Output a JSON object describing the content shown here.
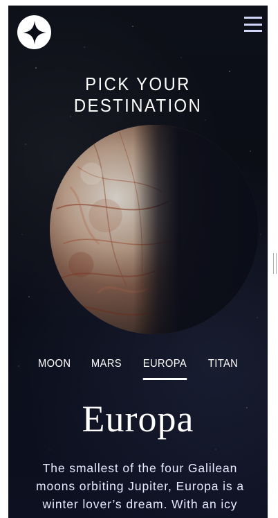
{
  "header": {
    "logo_icon": "four-point-star-icon",
    "menu_icon": "hamburger-menu-icon"
  },
  "page": {
    "heading": "PICK YOUR DESTINATION"
  },
  "destinations": {
    "tabs": [
      {
        "label": "MOON",
        "active": false
      },
      {
        "label": "MARS",
        "active": false
      },
      {
        "label": "EUROPA",
        "active": true
      },
      {
        "label": "TITAN",
        "active": false
      }
    ]
  },
  "destination": {
    "name": "Europa",
    "description": "The smallest of the four Galilean moons orbiting Jupiter, Europa is a winter lover’s dream. With an icy",
    "image_icon": "europa-planet-image"
  },
  "colors": {
    "background": "#0b0d16",
    "text": "#ffffff",
    "muted_text": "#d0d6f9",
    "accent": "#ffffff"
  }
}
